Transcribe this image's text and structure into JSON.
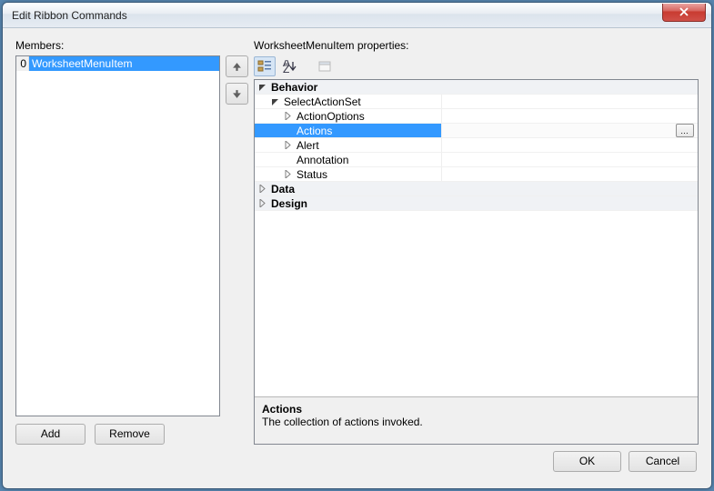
{
  "window": {
    "title": "Edit Ribbon Commands"
  },
  "members": {
    "label": "Members:",
    "items": [
      {
        "index": "0",
        "text": "WorksheetMenuItem",
        "selected": true
      }
    ],
    "add_label": "Add",
    "remove_label": "Remove"
  },
  "properties": {
    "label": "WorksheetMenuItem properties:",
    "toolbar": {
      "categorized": "categorized-icon",
      "alphabetical": "alphabetical-icon",
      "pages": "property-pages-icon"
    },
    "rows": [
      {
        "kind": "cat",
        "indent": 0,
        "exp": "open",
        "text": "Behavior"
      },
      {
        "kind": "node",
        "indent": 1,
        "exp": "open",
        "text": "SelectActionSet"
      },
      {
        "kind": "node",
        "indent": 2,
        "exp": "closed",
        "text": "ActionOptions"
      },
      {
        "kind": "sel",
        "indent": 2,
        "exp": "none",
        "text": "Actions",
        "ellipsis": true
      },
      {
        "kind": "node",
        "indent": 2,
        "exp": "closed",
        "text": "Alert"
      },
      {
        "kind": "leaf",
        "indent": 2,
        "exp": "none",
        "text": "Annotation"
      },
      {
        "kind": "node",
        "indent": 2,
        "exp": "closed",
        "text": "Status"
      },
      {
        "kind": "cat",
        "indent": 0,
        "exp": "closed",
        "text": "Data"
      },
      {
        "kind": "cat",
        "indent": 0,
        "exp": "closed",
        "text": "Design"
      }
    ],
    "help": {
      "title": "Actions",
      "desc": "The collection of actions invoked."
    }
  },
  "dialog": {
    "ok": "OK",
    "cancel": "Cancel"
  }
}
